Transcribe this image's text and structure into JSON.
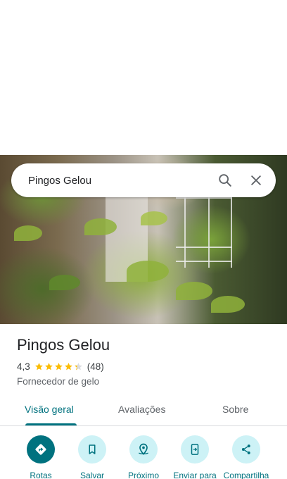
{
  "search": {
    "query": "Pingos Gelou"
  },
  "place": {
    "title": "Pingos Gelou",
    "rating": "4,3",
    "rating_value": 4.3,
    "review_count": "(48)",
    "category": "Fornecedor de gelo"
  },
  "tabs": [
    {
      "label": "Visão geral",
      "active": true
    },
    {
      "label": "Avaliações",
      "active": false
    },
    {
      "label": "Sobre",
      "active": false
    }
  ],
  "actions": [
    {
      "label": "Rotas",
      "icon": "directions-icon"
    },
    {
      "label": "Salvar",
      "icon": "bookmark-icon"
    },
    {
      "label": "Próximo",
      "icon": "nearby-icon"
    },
    {
      "label": "Enviar para",
      "icon": "send-to-phone-icon"
    },
    {
      "label": "Compartilha",
      "icon": "share-icon"
    }
  ],
  "colors": {
    "accent": "#00727f",
    "accent_light": "#cdf2f6",
    "star": "#fbbc04",
    "star_empty": "#dadce0"
  }
}
